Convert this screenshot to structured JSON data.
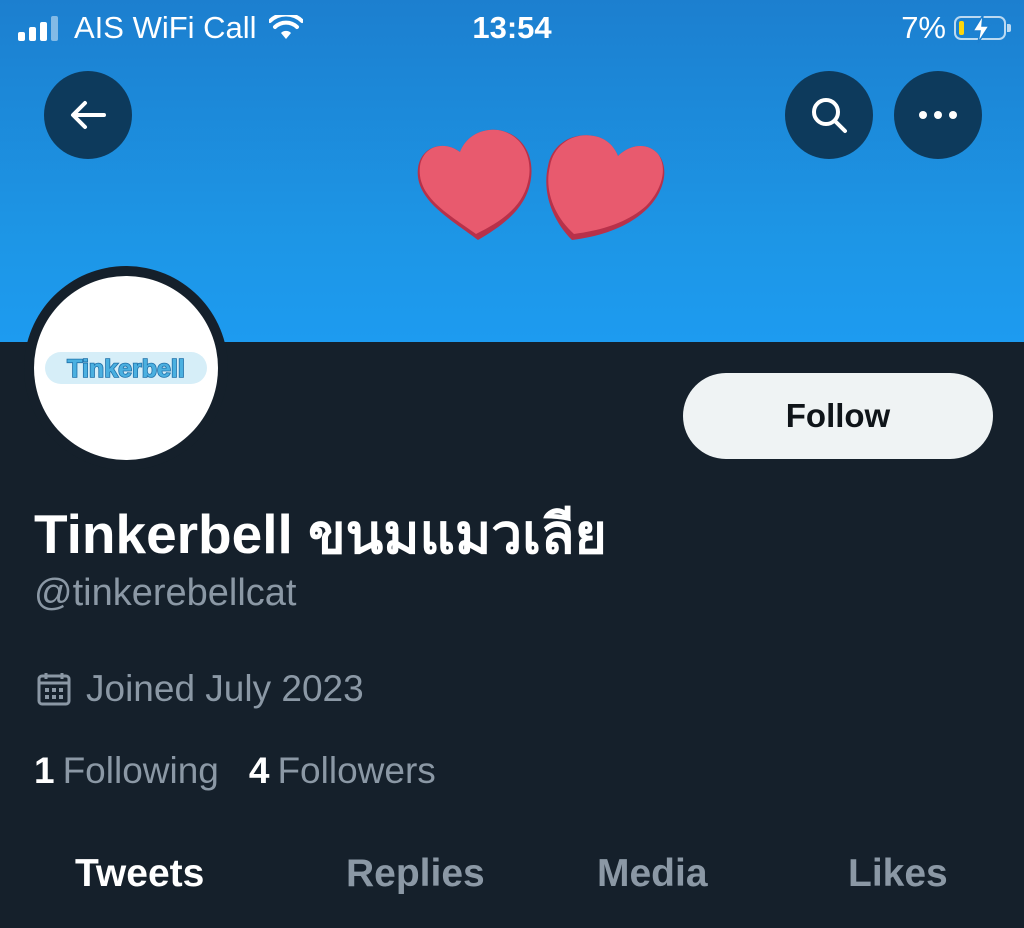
{
  "status_bar": {
    "carrier": "AIS WiFi Call",
    "time": "13:54",
    "battery_percent": "7%",
    "battery_level": 0.07,
    "battery_fill_color": "#ffd60a"
  },
  "header": {
    "back_icon": "arrow-left-icon",
    "search_icon": "search-icon",
    "more_icon": "more-horizontal-icon",
    "banner_color": "#1d9bf0"
  },
  "profile": {
    "avatar_logo_text": "Tinkerbell",
    "display_name": "Tinkerbell ขนมแมวเลีย",
    "handle": "@tinkerebellcat",
    "joined": "Joined July 2023",
    "following_count": "1",
    "following_label": "Following",
    "followers_count": "4",
    "followers_label": "Followers",
    "follow_button": "Follow"
  },
  "tabs": [
    {
      "label": "Tweets",
      "active": true
    },
    {
      "label": "Replies",
      "active": false
    },
    {
      "label": "Media",
      "active": false
    },
    {
      "label": "Likes",
      "active": false
    }
  ]
}
